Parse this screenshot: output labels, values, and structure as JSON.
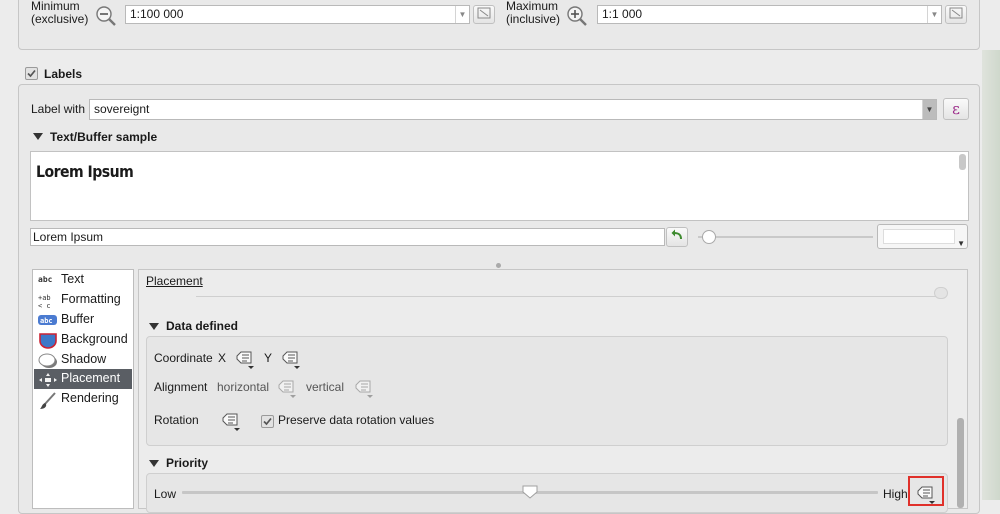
{
  "scale": {
    "minimum_label": "Minimum\n(exclusive)",
    "minimum_value": "1:100 000",
    "maximum_label": "Maximum\n(inclusive)",
    "maximum_value": "1:1 000"
  },
  "labels_checkbox": {
    "label": "Labels",
    "checked": true
  },
  "label_with": {
    "label": "Label with",
    "value": "sovereignt",
    "expression_button": "ε"
  },
  "text_buffer_sample": {
    "header": "Text/Buffer sample",
    "preview_text": "Lorem Ipsum",
    "input_value": "Lorem Ipsum"
  },
  "sidebar": {
    "items": [
      {
        "label": "Text",
        "icon": "abc"
      },
      {
        "label": "Formatting",
        "icon": "+ab"
      },
      {
        "label": "Buffer",
        "icon": "abc"
      },
      {
        "label": "Background",
        "icon": "shield"
      },
      {
        "label": "Shadow",
        "icon": "shadow"
      },
      {
        "label": "Placement",
        "icon": "placement",
        "selected": true
      },
      {
        "label": "Rendering",
        "icon": "brush"
      }
    ]
  },
  "placement": {
    "title": "Placement",
    "data_defined": {
      "header": "Data defined",
      "coordinate_label": "Coordinate",
      "x_label": "X",
      "y_label": "Y",
      "alignment_label": "Alignment",
      "horizontal_label": "horizontal",
      "vertical_label": "vertical",
      "rotation_label": "Rotation",
      "preserve_rotation_label": "Preserve data rotation values",
      "preserve_rotation_checked": true
    },
    "priority": {
      "header": "Priority",
      "low_label": "Low",
      "high_label": "High",
      "level": 0.5
    }
  },
  "colors": {
    "selected_bg": "#5a5e64",
    "highlight_box": "#e0302a",
    "expression_icon": "#9c2b8a"
  }
}
